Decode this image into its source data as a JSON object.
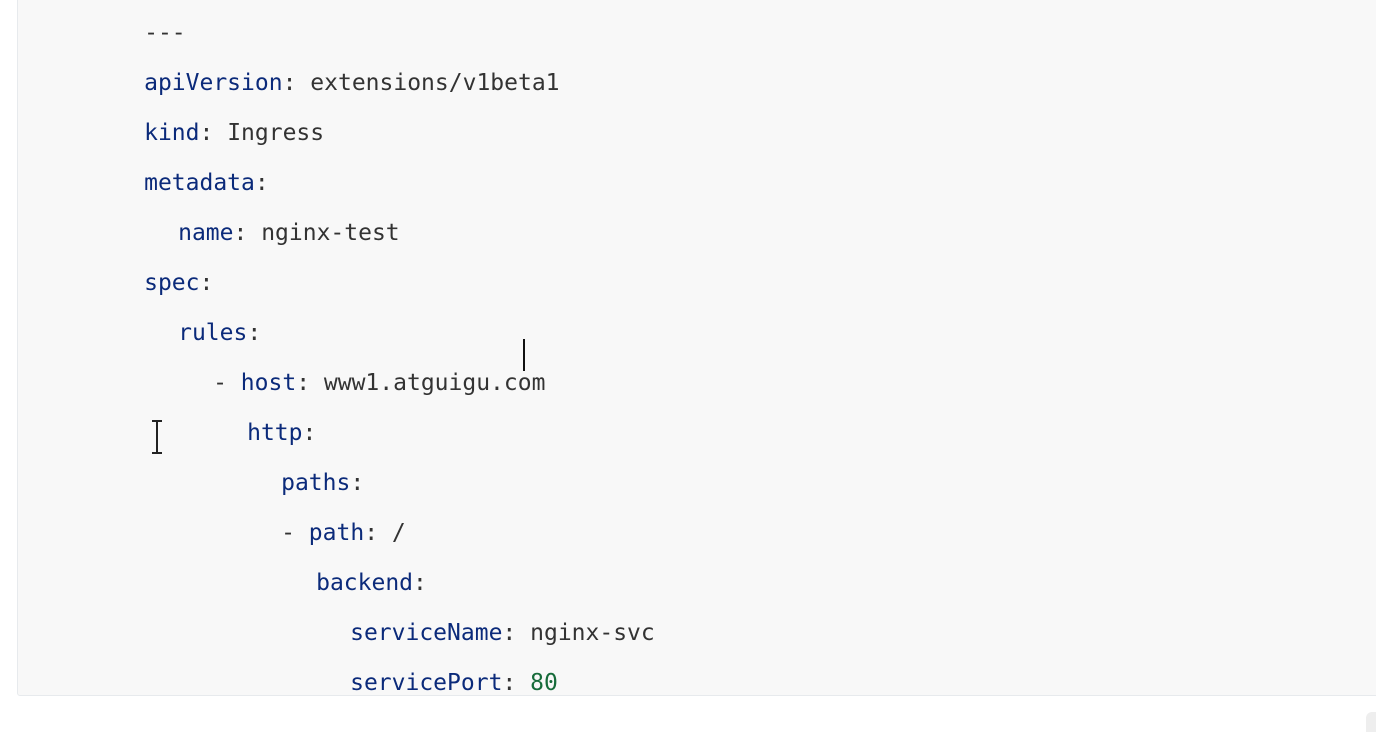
{
  "code": {
    "language": "yaml",
    "doc_separator": "---",
    "lines": [
      {
        "key": "apiVersion",
        "sep": ": ",
        "value": "extensions/v1beta1"
      },
      {
        "key": "kind",
        "sep": ": ",
        "value": "Ingress"
      },
      {
        "key": "metadata",
        "sep": ":",
        "value": ""
      },
      {
        "key": "name",
        "sep": ": ",
        "value": "nginx-test"
      },
      {
        "key": "spec",
        "sep": ":",
        "value": ""
      },
      {
        "key": "rules",
        "sep": ":",
        "value": ""
      },
      {
        "dash": "- ",
        "key": "host",
        "sep": ": ",
        "value": "www1.atguigu.com"
      },
      {
        "key": "http",
        "sep": ":",
        "value": ""
      },
      {
        "key": "paths",
        "sep": ":",
        "value": ""
      },
      {
        "dash": "- ",
        "key": "path",
        "sep": ": ",
        "value": "/"
      },
      {
        "key": "backend",
        "sep": ":",
        "value": ""
      },
      {
        "key": "serviceName",
        "sep": ": ",
        "value": "nginx-svc"
      },
      {
        "key": "servicePort",
        "sep": ": ",
        "value": "80"
      }
    ]
  },
  "colors": {
    "key": "#0b2a7a",
    "string": "#333333",
    "number": "#166b3a",
    "background": "#f8f8f8"
  },
  "icons": {
    "text_cursor": "text-caret",
    "mouse_pointer": "ibeam-cursor-icon"
  }
}
